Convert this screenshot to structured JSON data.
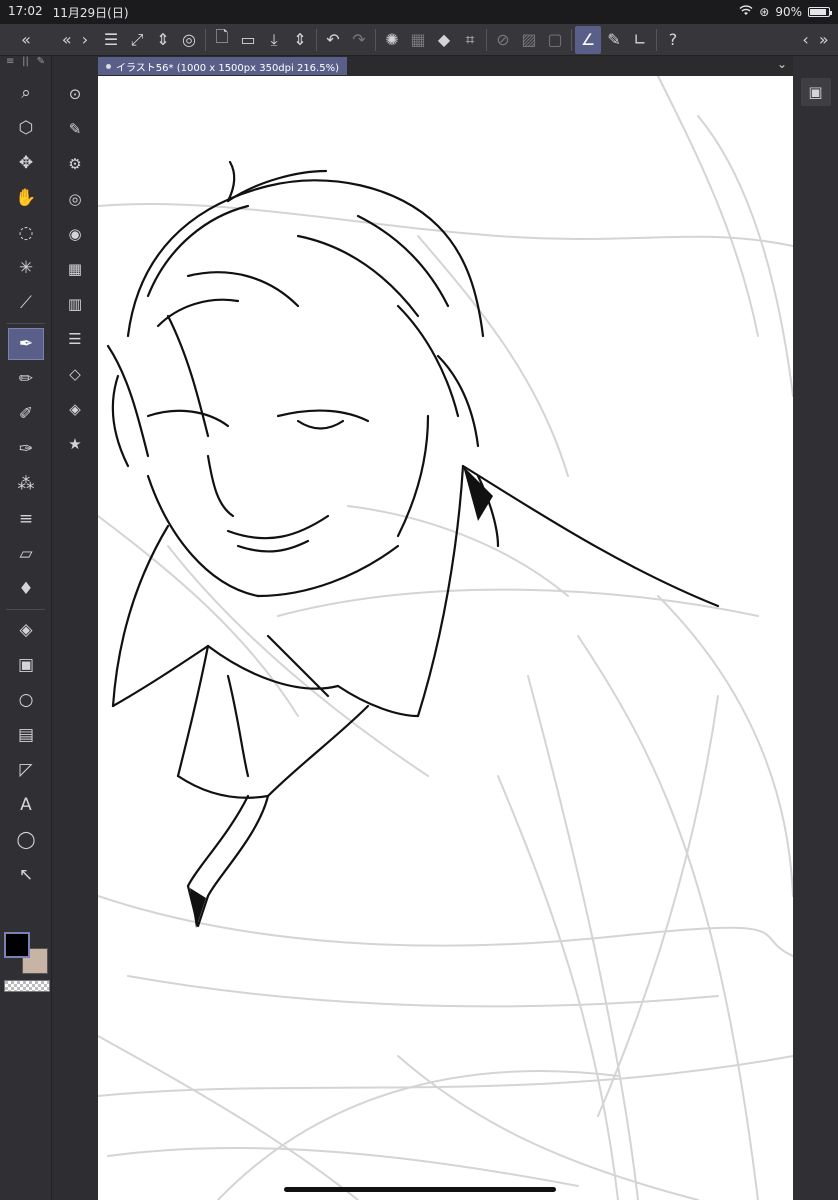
{
  "status_bar": {
    "time": "17:02",
    "date": "11月29日(日)",
    "battery": "90%",
    "battery_level": 0.9
  },
  "toolbar": {
    "icons": [
      "menu-icon",
      "transform-icon",
      "updown-icon",
      "spiral-icon",
      "new-file-icon",
      "open-folder-icon",
      "save-icon",
      "updown-icon",
      "undo-icon",
      "redo-icon",
      "select-all-icon",
      "deselect-icon",
      "fill-icon",
      "crop-icon",
      "snap-off-icon",
      "snap-grid-icon",
      "snap-ruler-icon",
      "ruler-active-icon",
      "brush-icon",
      "angle-ruler-icon",
      "help-icon"
    ]
  },
  "canvas_tab": {
    "label": "イラスト56* (1000 x 1500px 350dpi 216.5%)"
  },
  "colors": {
    "main_color": "#000000",
    "sub_color": "#c8b4a4",
    "accent": "#5a5f8a",
    "canvas_bg": "#ffffff"
  },
  "left_tools": [
    "zoom-icon",
    "move-layer-icon",
    "move-icon",
    "hand-icon",
    "lasso-icon",
    "magic-wand-icon",
    "eyedropper-icon",
    "pen-icon",
    "pencil-icon",
    "brush-pen-icon",
    "marker-icon",
    "airbrush-icon",
    "hatch-icon",
    "eraser-icon",
    "blend-icon",
    "fill-bucket-icon",
    "gradient-icon",
    "ellipse-icon",
    "frame-icon",
    "ruler-icon",
    "text-icon",
    "speech-balloon-icon",
    "operation-icon"
  ],
  "sub_tools": [
    "navigator-icon",
    "sub-tool-pen-icon",
    "sub-tool-settings-icon",
    "brush-size-icon",
    "color-wheel-icon",
    "color-set-icon",
    "timeline-icon",
    "layer-property-icon",
    "layer-search-icon",
    "layers-icon",
    "material-icon"
  ]
}
